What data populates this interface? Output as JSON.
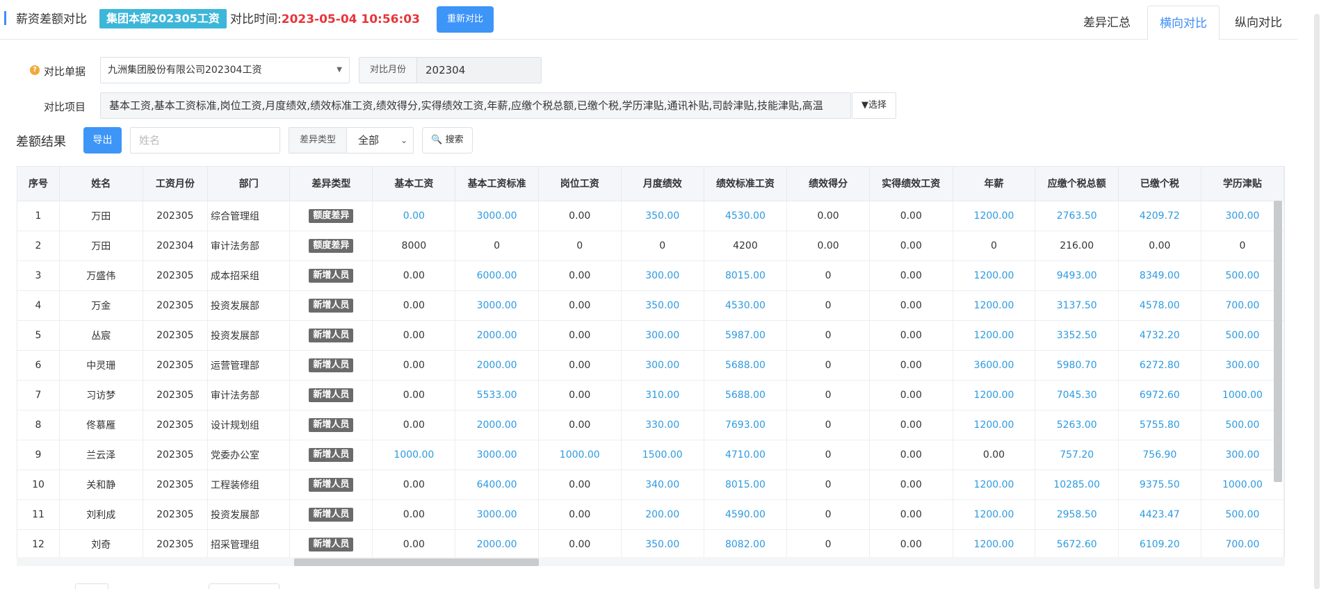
{
  "header": {
    "title": "薪资差额对比",
    "tag": "集团本部202305工资",
    "compare_time_label": "对比时间:",
    "compare_time_value": "2023-05-04 10:56:03",
    "recompare_button": "重新对比",
    "tabs": [
      {
        "label": "差异汇总",
        "active": false
      },
      {
        "label": "横向对比",
        "active": true
      },
      {
        "label": "纵向对比",
        "active": false
      }
    ]
  },
  "form": {
    "compare_doc_label": "对比单据",
    "compare_doc_value": "九洲集团股份有限公司202304工资",
    "compare_month_label": "对比月份",
    "compare_month_value": "202304",
    "compare_items_label": "对比项目",
    "compare_items_value": "基本工资,基本工资标准,岗位工资,月度绩效,绩效标准工资,绩效得分,实得绩效工资,年薪,应缴个税总额,已缴个税,学历津贴,通讯补贴,司龄津贴,技能津贴,高温",
    "choose_button": "选择"
  },
  "toolbar": {
    "result_label": "差额结果",
    "export_button": "导出",
    "name_placeholder": "姓名",
    "diff_type_label": "差异类型",
    "diff_type_value": "全部",
    "search_button": "搜索"
  },
  "colors": {
    "accent": "#3d8ef8",
    "tag_bg": "#3db7d9",
    "time_red": "#e8343a",
    "link_blue": "#2d9ae0",
    "diff_tag_bg": "#6b6b6b"
  },
  "table": {
    "columns": [
      "序号",
      "姓名",
      "工资月份",
      "部门",
      "差异类型",
      "基本工资",
      "基本工资标准",
      "岗位工资",
      "月度绩效",
      "绩效标准工资",
      "绩效得分",
      "实得绩效工资",
      "年薪",
      "应缴个税总额",
      "已缴个税",
      "学历津贴"
    ],
    "rows": [
      {
        "cells": [
          "1",
          "万田",
          "202305",
          "综合管理组",
          "额度差异",
          "0.00",
          "3000.00",
          "0.00",
          "350.00",
          "4530.00",
          "0.00",
          "0.00",
          "1200.00",
          "2763.50",
          "4209.72",
          "300.00"
        ],
        "links": [
          5,
          6,
          8,
          9,
          12,
          13,
          14,
          15
        ]
      },
      {
        "cells": [
          "2",
          "万田",
          "202304",
          "审计法务部",
          "额度差异",
          "8000",
          "0",
          "0",
          "0",
          "4200",
          "0.00",
          "0.00",
          "0",
          "216.00",
          "0.00",
          "0"
        ],
        "links": []
      },
      {
        "cells": [
          "3",
          "万盛伟",
          "202305",
          "成本招采组",
          "新增人员",
          "0.00",
          "6000.00",
          "0.00",
          "300.00",
          "8015.00",
          "0",
          "0.00",
          "1200.00",
          "9493.00",
          "8349.00",
          "500.00"
        ],
        "links": [
          6,
          8,
          9,
          12,
          13,
          14,
          15
        ]
      },
      {
        "cells": [
          "4",
          "万金",
          "202305",
          "投资发展部",
          "新增人员",
          "0.00",
          "3000.00",
          "0.00",
          "350.00",
          "4530.00",
          "0",
          "0.00",
          "1200.00",
          "3137.50",
          "4578.00",
          "700.00"
        ],
        "links": [
          6,
          8,
          9,
          12,
          13,
          14,
          15
        ]
      },
      {
        "cells": [
          "5",
          "丛宸",
          "202305",
          "投资发展部",
          "新增人员",
          "0.00",
          "2000.00",
          "0.00",
          "300.00",
          "5987.00",
          "0",
          "0.00",
          "1200.00",
          "3352.50",
          "4732.20",
          "500.00"
        ],
        "links": [
          6,
          8,
          9,
          12,
          13,
          14,
          15
        ]
      },
      {
        "cells": [
          "6",
          "中灵珊",
          "202305",
          "运营管理部",
          "新增人员",
          "0.00",
          "2000.00",
          "0.00",
          "300.00",
          "5688.00",
          "0",
          "0.00",
          "3600.00",
          "5980.70",
          "6272.80",
          "300.00"
        ],
        "links": [
          6,
          8,
          9,
          12,
          13,
          14,
          15
        ]
      },
      {
        "cells": [
          "7",
          "习访梦",
          "202305",
          "审计法务部",
          "新增人员",
          "0.00",
          "5533.00",
          "0.00",
          "310.00",
          "5688.00",
          "0",
          "0.00",
          "1200.00",
          "7045.30",
          "6972.60",
          "1000.00"
        ],
        "links": [
          6,
          8,
          9,
          12,
          13,
          14,
          15
        ]
      },
      {
        "cells": [
          "8",
          "佟慕雁",
          "202305",
          "设计规划组",
          "新增人员",
          "0.00",
          "2000.00",
          "0.00",
          "330.00",
          "7693.00",
          "0",
          "0.00",
          "1200.00",
          "5263.00",
          "5755.80",
          "500.00"
        ],
        "links": [
          6,
          8,
          9,
          12,
          13,
          14,
          15
        ]
      },
      {
        "cells": [
          "9",
          "兰云泽",
          "202305",
          "党委办公室",
          "新增人员",
          "1000.00",
          "3000.00",
          "1000.00",
          "1500.00",
          "4710.00",
          "0",
          "0.00",
          "0.00",
          "757.20",
          "756.90",
          "300.00"
        ],
        "links": [
          5,
          6,
          7,
          8,
          9,
          13,
          14,
          15
        ]
      },
      {
        "cells": [
          "10",
          "关和静",
          "202305",
          "工程装修组",
          "新增人员",
          "0.00",
          "6400.00",
          "0.00",
          "340.00",
          "8015.00",
          "0",
          "0.00",
          "1200.00",
          "10285.00",
          "9375.50",
          "1000.00"
        ],
        "links": [
          6,
          8,
          9,
          12,
          13,
          14,
          15
        ]
      },
      {
        "cells": [
          "11",
          "刘利成",
          "202305",
          "投资发展部",
          "新增人员",
          "0.00",
          "3000.00",
          "0.00",
          "200.00",
          "4590.00",
          "0",
          "0.00",
          "1200.00",
          "2958.50",
          "4423.47",
          "500.00"
        ],
        "links": [
          6,
          8,
          9,
          12,
          13,
          14,
          15
        ]
      },
      {
        "cells": [
          "12",
          "刘奇",
          "202305",
          "招采管理组",
          "新增人员",
          "0.00",
          "2000.00",
          "0.00",
          "350.00",
          "8082.00",
          "0",
          "0.00",
          "1200.00",
          "5672.60",
          "6109.20",
          "700.00"
        ],
        "links": [
          6,
          8,
          9,
          12,
          13,
          14,
          15
        ]
      }
    ]
  }
}
